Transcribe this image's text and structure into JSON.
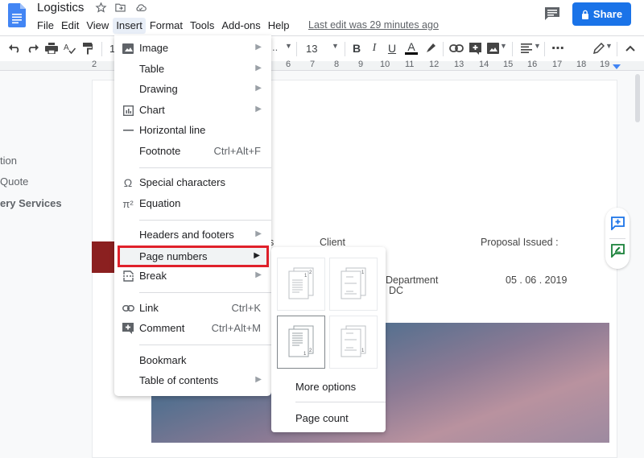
{
  "app": {
    "title": "Logistics",
    "last_edit": "Last edit was 29 minutes ago",
    "share_label": "Share"
  },
  "menubar": [
    "File",
    "Edit",
    "View",
    "Insert",
    "Format",
    "Tools",
    "Add-ons",
    "Help"
  ],
  "toolbar": {
    "zoom_partial": "1",
    "font_partial": "..",
    "font_size": "13",
    "more": "⋯"
  },
  "ruler": [
    "2",
    "6",
    "7",
    "8",
    "9",
    "10",
    "11",
    "12",
    "13",
    "14",
    "15",
    "16",
    "17",
    "18",
    "19"
  ],
  "outline": {
    "items": [
      "tion",
      "Quote",
      "ery Services"
    ]
  },
  "document": {
    "partial_s": "s",
    "client_label": "Client",
    "proposal_label": "Proposal Issued :",
    "client_line1": "Department",
    "client_line2": "DC",
    "proposal_date": "05 . 06 . 2019"
  },
  "insert_menu": {
    "items": [
      {
        "label": "Image",
        "icon": "image-icon",
        "submenu": true
      },
      {
        "label": "Table",
        "submenu": true
      },
      {
        "label": "Drawing",
        "submenu": true
      },
      {
        "label": "Chart",
        "icon": "chart-icon",
        "submenu": true
      },
      {
        "label": "Horizontal line",
        "icon": "horizontal-line-icon"
      },
      {
        "label": "Footnote",
        "shortcut": "Ctrl+Alt+F"
      },
      {
        "label": "Special characters",
        "icon": "omega-icon"
      },
      {
        "label": "Equation",
        "icon": "pi-icon"
      },
      {
        "label": "Headers and footers",
        "submenu": true
      },
      {
        "label": "Page numbers",
        "submenu": true,
        "highlighted": true
      },
      {
        "label": "Break",
        "icon": "break-icon",
        "submenu": true
      },
      {
        "label": "Link",
        "icon": "link-icon",
        "shortcut": "Ctrl+K"
      },
      {
        "label": "Comment",
        "icon": "comment-icon",
        "shortcut": "Ctrl+Alt+M"
      },
      {
        "label": "Bookmark"
      },
      {
        "label": "Table of contents",
        "submenu": true
      }
    ]
  },
  "page_numbers_submenu": {
    "options": [
      {
        "name": "header-all-pages",
        "selected": false
      },
      {
        "name": "header-skip-first",
        "selected": false
      },
      {
        "name": "footer-all-pages",
        "selected": true
      },
      {
        "name": "footer-skip-first",
        "selected": false
      }
    ],
    "more_options": "More options",
    "page_count": "Page count"
  },
  "colors": {
    "accent": "#1a73e8",
    "highlight_border": "#e0202a",
    "red_block": "#8b2020"
  }
}
